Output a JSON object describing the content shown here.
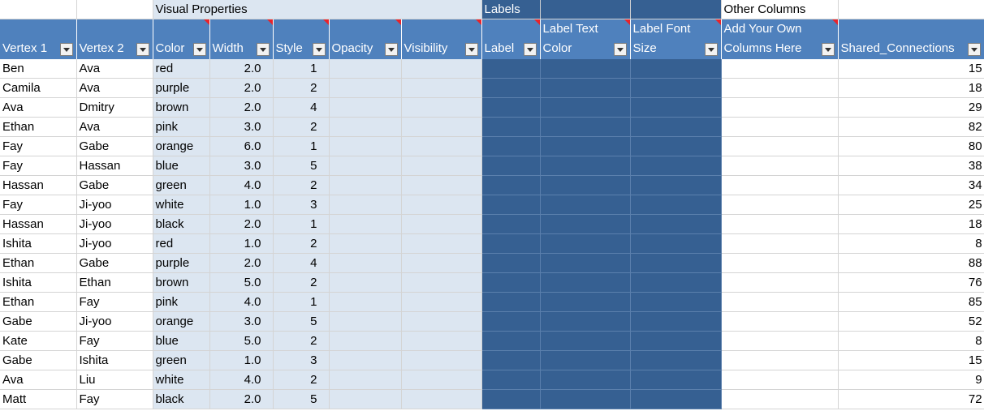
{
  "groups": {
    "visual": "Visual Properties",
    "labels": "Labels",
    "other": "Other Columns"
  },
  "headers": {
    "vertex1": "Vertex 1",
    "vertex2": "Vertex 2",
    "color": "Color",
    "width": "Width",
    "style": "Style",
    "opacity": "Opacity",
    "visibility": "Visibility",
    "label": "Label",
    "label_text_color": "Label Text Color",
    "label_font_size": "Label Font Size",
    "add_columns": "Add Your Own Columns Here",
    "shared": "Shared_Connections"
  },
  "rows": [
    {
      "v1": "Ben",
      "v2": "Ava",
      "color": "red",
      "width": "2.0",
      "style": "1",
      "shared": "15"
    },
    {
      "v1": "Camila",
      "v2": "Ava",
      "color": "purple",
      "width": "2.0",
      "style": "2",
      "shared": "18"
    },
    {
      "v1": "Ava",
      "v2": "Dmitry",
      "color": "brown",
      "width": "2.0",
      "style": "4",
      "shared": "29"
    },
    {
      "v1": "Ethan",
      "v2": "Ava",
      "color": "pink",
      "width": "3.0",
      "style": "2",
      "shared": "82"
    },
    {
      "v1": "Fay",
      "v2": "Gabe",
      "color": "orange",
      "width": "6.0",
      "style": "1",
      "shared": "80"
    },
    {
      "v1": "Fay",
      "v2": "Hassan",
      "color": "blue",
      "width": "3.0",
      "style": "5",
      "shared": "38"
    },
    {
      "v1": "Hassan",
      "v2": "Gabe",
      "color": "green",
      "width": "4.0",
      "style": "2",
      "shared": "34"
    },
    {
      "v1": "Fay",
      "v2": "Ji-yoo",
      "color": "white",
      "width": "1.0",
      "style": "3",
      "shared": "25"
    },
    {
      "v1": "Hassan",
      "v2": "Ji-yoo",
      "color": "black",
      "width": "2.0",
      "style": "1",
      "shared": "18"
    },
    {
      "v1": "Ishita",
      "v2": "Ji-yoo",
      "color": "red",
      "width": "1.0",
      "style": "2",
      "shared": "8"
    },
    {
      "v1": "Ethan",
      "v2": "Gabe",
      "color": "purple",
      "width": "2.0",
      "style": "4",
      "shared": "88"
    },
    {
      "v1": "Ishita",
      "v2": "Ethan",
      "color": "brown",
      "width": "5.0",
      "style": "2",
      "shared": "76"
    },
    {
      "v1": "Ethan",
      "v2": "Fay",
      "color": "pink",
      "width": "4.0",
      "style": "1",
      "shared": "85"
    },
    {
      "v1": "Gabe",
      "v2": "Ji-yoo",
      "color": "orange",
      "width": "3.0",
      "style": "5",
      "shared": "52"
    },
    {
      "v1": "Kate",
      "v2": "Fay",
      "color": "blue",
      "width": "5.0",
      "style": "2",
      "shared": "8"
    },
    {
      "v1": "Gabe",
      "v2": "Ishita",
      "color": "green",
      "width": "1.0",
      "style": "3",
      "shared": "15"
    },
    {
      "v1": "Ava",
      "v2": "Liu",
      "color": "white",
      "width": "4.0",
      "style": "2",
      "shared": "9"
    },
    {
      "v1": "Matt",
      "v2": "Fay",
      "color": "black",
      "width": "2.0",
      "style": "5",
      "shared": "72"
    }
  ]
}
